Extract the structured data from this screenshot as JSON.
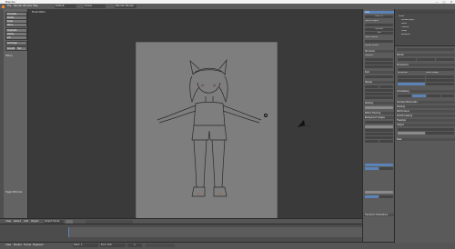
{
  "window": {
    "title": "Blender",
    "buttons": [
      "—",
      "□",
      "✕"
    ]
  },
  "info_header": {
    "menus": [
      "File",
      "Render",
      "Window",
      "Help"
    ],
    "layout": "Default",
    "scene": "Scene",
    "engine": "Blender Render"
  },
  "viewport": {
    "label": "Front Ortho",
    "header_items": [
      "View",
      "Select",
      "Add",
      "Object",
      "Object Mode"
    ]
  },
  "toolshelf": {
    "buttons": [
      "Translate",
      "Rotate",
      "Scale",
      "Mirror",
      "Duplicate",
      "Delete",
      "Join",
      "Set Origin",
      "Smooth",
      "Flat"
    ],
    "section": "History",
    "footer": "Toggle Editmode"
  },
  "timeline": {
    "menus": [
      "View",
      "Marker",
      "Frame",
      "Playback"
    ],
    "start": "Start: 1",
    "end": "End: 250",
    "frame": "1"
  },
  "right": {
    "view_panel": [
      "View",
      "Lens: 35",
      "Lock to Object",
      "Clip Start",
      "End",
      "Local Camera",
      "Render Border",
      "3D Cursor",
      "Location",
      "Item",
      "Display",
      "Shading",
      "Motion Tracking",
      "Background Images",
      "Transform Orientations"
    ],
    "outliner_items": [
      "Scene",
      "RenderLayers",
      "World",
      "Camera",
      "Lamp",
      "Armature"
    ],
    "properties": [
      "Render",
      "Dimensions",
      "Resolution",
      "Frame Range",
      "Anti-Aliasing",
      "Sampled Motion Blur",
      "Shading",
      "Performance",
      "Post Processing",
      "Freestyle",
      "Output",
      "Bake"
    ]
  },
  "colors": {
    "accent": "#5b83b8",
    "camera_bg": "#7e7e7e",
    "viewport_bg": "#3a3a3a"
  }
}
